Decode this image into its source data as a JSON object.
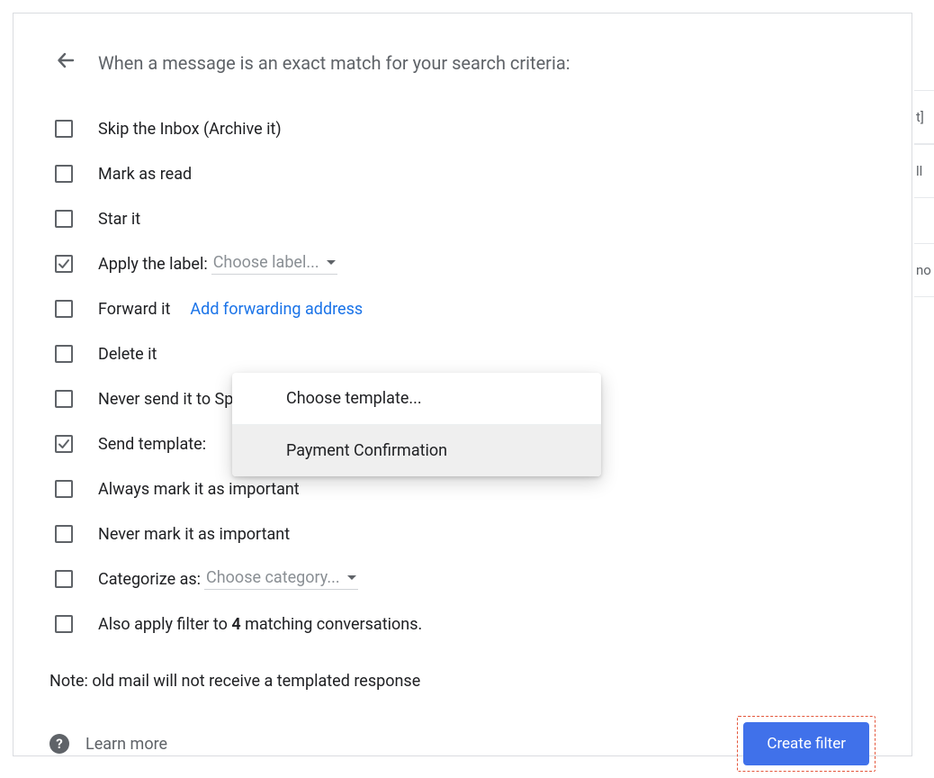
{
  "dialog": {
    "title": "When a message is an exact match for your search criteria:",
    "options": {
      "skip_inbox": {
        "label": "Skip the Inbox (Archive it)",
        "checked": false
      },
      "mark_read": {
        "label": "Mark as read",
        "checked": false
      },
      "star": {
        "label": "Star it",
        "checked": false
      },
      "apply_label": {
        "label": "Apply the label:",
        "checked": true,
        "select": "Choose label..."
      },
      "forward": {
        "label": "Forward it",
        "checked": false,
        "link": "Add forwarding address"
      },
      "delete": {
        "label": "Delete it",
        "checked": false
      },
      "never_spam": {
        "label": "Never send it to Spam",
        "checked": false
      },
      "send_template": {
        "label": "Send template:",
        "checked": true
      },
      "always_important": {
        "label": "Always mark it as important",
        "checked": false
      },
      "never_important": {
        "label": "Never mark it as important",
        "checked": false
      },
      "categorize": {
        "label": "Categorize as:",
        "checked": false,
        "select": "Choose category..."
      },
      "also_apply": {
        "label_pre": "Also apply filter to ",
        "count": "4",
        "label_post": " matching conversations.",
        "checked": false
      }
    },
    "note": "Note: old mail will not receive a templated response",
    "learn_more": "Learn more",
    "create_button": "Create filter"
  },
  "template_menu": {
    "placeholder": "Choose template...",
    "items": [
      "Payment Confirmation"
    ],
    "highlighted_index": 0
  },
  "side_peek": [
    "t]",
    "ll",
    "no"
  ]
}
